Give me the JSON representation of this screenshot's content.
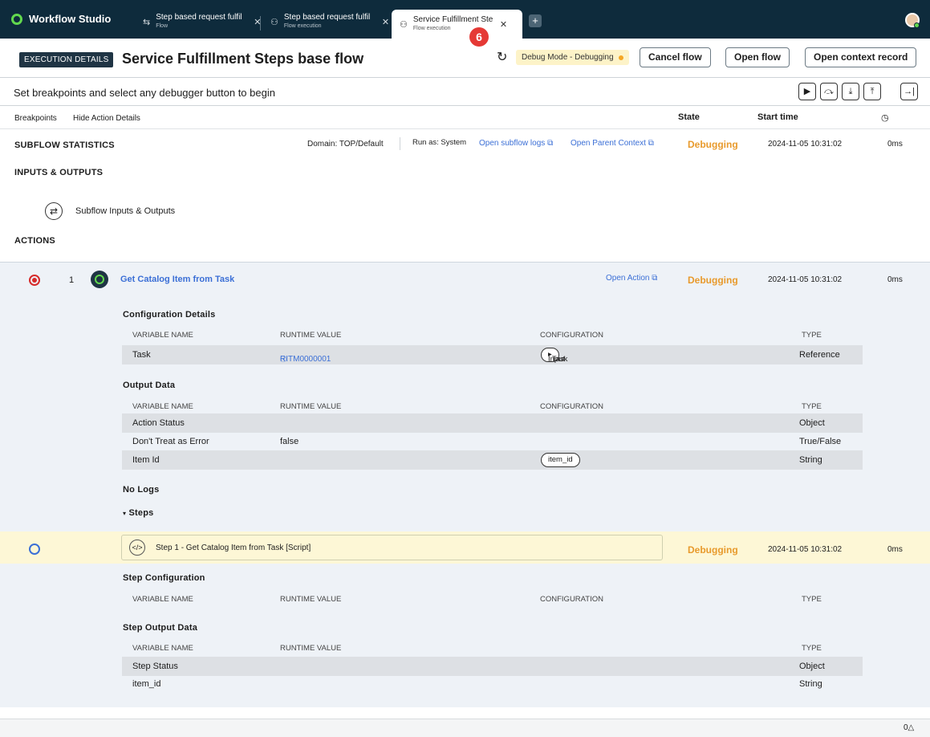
{
  "app": {
    "name": "Workflow Studio"
  },
  "tabs": [
    {
      "title": "Step based request fulfil",
      "subtitle": "Flow"
    },
    {
      "title": "Step based request fulfil",
      "subtitle": "Flow execution"
    },
    {
      "title": "Service Fulfillment Steps",
      "subtitle": "Flow execution"
    }
  ],
  "tab_add": "+",
  "badge": "6",
  "header": {
    "tag": "EXECUTION DETAILS",
    "title": "Service Fulfillment Steps base flow",
    "debug_mode": "Debug Mode - Debugging",
    "cancel": "Cancel flow",
    "open_flow": "Open flow",
    "open_context": "Open context record"
  },
  "hint": "Set breakpoints and select any debugger button to begin",
  "debug_buttons": [
    "▶",
    "⤼",
    "⤓",
    "⤒",
    "→|"
  ],
  "columns": {
    "breakpoints": "Breakpoints",
    "hide": "Hide Action Details",
    "state": "State",
    "start": "Start time",
    "duration_icon": "◷"
  },
  "subflow": {
    "label": "SUBFLOW STATISTICS",
    "domain": "Domain: TOP/Default",
    "run_as": "Run as: System",
    "logs": "Open subflow logs",
    "parent": "Open Parent Context",
    "state": "Debugging",
    "start": "2024-11-05 10:31:02",
    "duration": "0ms"
  },
  "inputs_outputs": {
    "label": "INPUTS & OUTPUTS",
    "item": "Subflow Inputs & Outputs"
  },
  "actions_label": "ACTIONS",
  "action": {
    "index": "1",
    "name": "Get Catalog Item from Task",
    "open": "Open Action",
    "state": "Debugging",
    "start": "2024-11-05 10:31:02",
    "duration": "0ms"
  },
  "headers": {
    "var": "VARIABLE NAME",
    "val": "RUNTIME VALUE",
    "cfg": "CONFIGURATION",
    "type": "TYPE"
  },
  "config_details": {
    "title": "Configuration Details",
    "rows": [
      {
        "name": "Task",
        "value": "RITM0000001",
        "cfg_a": "Input",
        "cfg_b": "Task",
        "type": "Reference"
      }
    ]
  },
  "output_data": {
    "title": "Output Data",
    "rows": [
      {
        "name": "Action Status",
        "value": "",
        "type": "Object"
      },
      {
        "name": "Don't Treat as Error",
        "value": "false",
        "type": "True/False"
      },
      {
        "name": "Item Id",
        "value": "",
        "cfg": "item_id",
        "type": "String"
      }
    ]
  },
  "no_logs": "No Logs",
  "steps_label": "Steps",
  "step": {
    "name": "Step 1 - Get Catalog Item from Task [Script]",
    "state": "Debugging",
    "start": "2024-11-05 10:31:02",
    "duration": "0ms"
  },
  "step_config": {
    "title": "Step Configuration"
  },
  "step_output": {
    "title": "Step Output Data",
    "rows": [
      {
        "name": "Step Status",
        "type": "Object"
      },
      {
        "name": "item_id",
        "type": "String"
      }
    ]
  },
  "footer": {
    "counter": "0△"
  }
}
